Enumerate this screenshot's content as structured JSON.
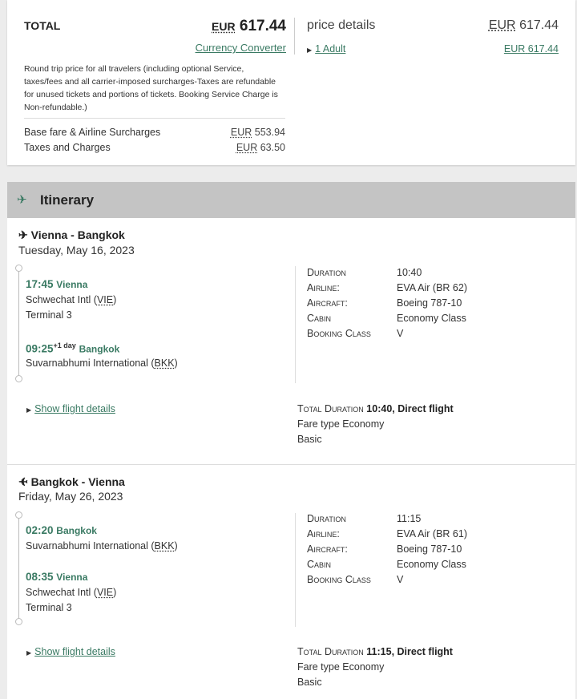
{
  "price": {
    "total_label": "TOTAL",
    "currency": "EUR",
    "total_value": "617.44",
    "converter_link": "Currency Converter",
    "note": "Round trip price for all travelers (including optional Service, taxes/fees and all carrier-imposed surcharges-Taxes are refundable for unused tickets and portions of tickets. Booking Service Charge is Non-refundable.)",
    "rows": [
      {
        "label": "Base fare & Airline Surcharges",
        "value": "553.94"
      },
      {
        "label": "Taxes and Charges",
        "value": "63.50"
      }
    ],
    "details_title": "price details",
    "details_total": "617.44",
    "adult_link": "1 Adult",
    "adult_price": "617.44"
  },
  "itinerary": {
    "title": "Itinerary",
    "flights": [
      {
        "route": "Vienna - Bangkok",
        "date": "Tuesday, May 16, 2023",
        "dep_time": "17:45",
        "dep_city": "Vienna",
        "dep_airport": "Schwechat Intl",
        "dep_code": "VIE",
        "dep_terminal": "Terminal 3",
        "arr_time": "09:25",
        "arr_offset": "+1 day",
        "arr_city": "Bangkok",
        "arr_airport": "Suvarnabhumi International",
        "arr_code": "BKK",
        "arr_terminal": "",
        "duration": "10:40",
        "airline": "EVA Air (BR 62)",
        "aircraft": "Boeing 787-10",
        "cabin": "Economy Class",
        "booking_class": "V",
        "show_details": "Show flight details",
        "total_duration_label": "Total Duration",
        "total_duration_value": "10:40, Direct flight",
        "fare_type": "Fare type Economy",
        "fare_basic": "Basic"
      },
      {
        "route": "Bangkok - Vienna",
        "date": "Friday, May 26, 2023",
        "dep_time": "02:20",
        "dep_city": "Bangkok",
        "dep_airport": "Suvarnabhumi International",
        "dep_code": "BKK",
        "dep_terminal": "",
        "arr_time": "08:35",
        "arr_offset": "",
        "arr_city": "Vienna",
        "arr_airport": "Schwechat Intl",
        "arr_code": "VIE",
        "arr_terminal": "Terminal 3",
        "duration": "11:15",
        "airline": "EVA Air (BR 61)",
        "aircraft": "Boeing 787-10",
        "cabin": "Economy Class",
        "booking_class": "V",
        "show_details": "Show flight details",
        "total_duration_label": "Total Duration",
        "total_duration_value": "11:15, Direct flight",
        "fare_type": "Fare type Economy",
        "fare_basic": "Basic"
      }
    ],
    "labels": {
      "duration": "Duration",
      "airline": "Airline:",
      "aircraft": "Aircraft:",
      "cabin": "Cabin",
      "booking_class": "Booking Class"
    }
  },
  "colors": {
    "accent": "#3a7a63",
    "header_bg": "#c4c4c4",
    "page_bg": "#ececec"
  },
  "icons": {
    "plane": "airplane-icon",
    "caret": "caret-right-icon"
  }
}
